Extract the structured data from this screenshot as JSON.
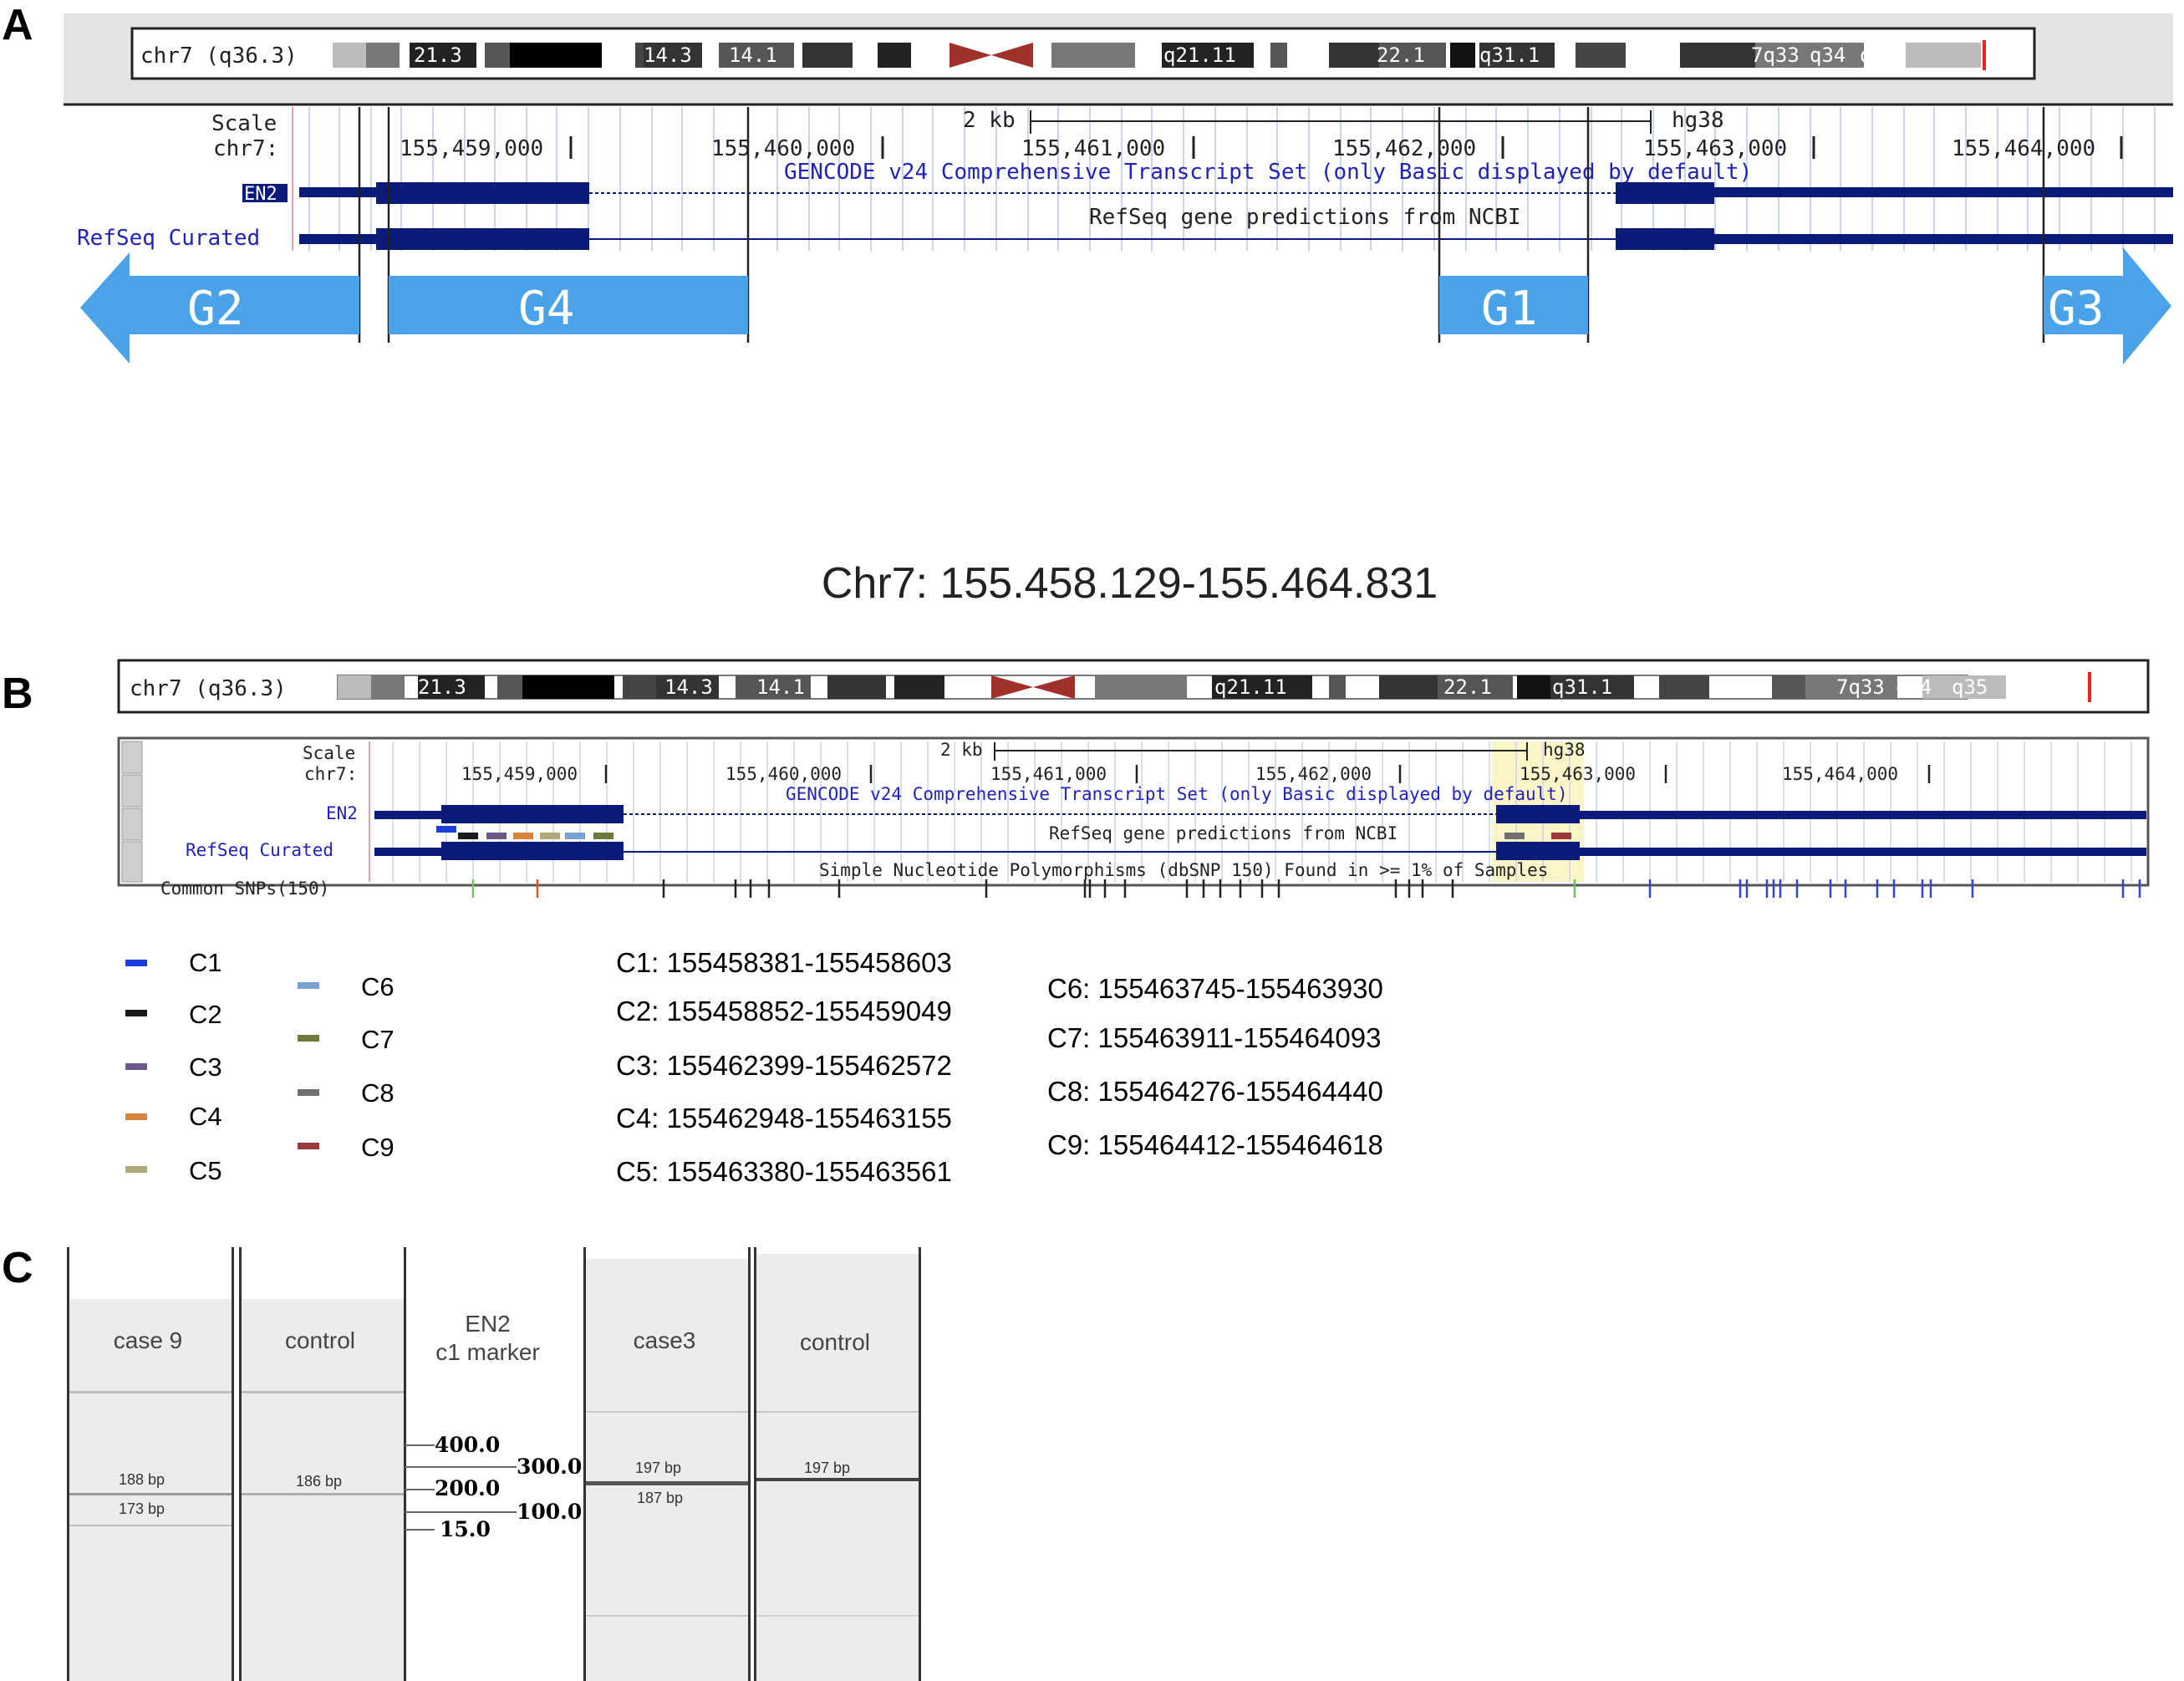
{
  "panels": {
    "a": {
      "letter": "A"
    },
    "b": {
      "letter": "B"
    },
    "c": {
      "letter": "C"
    }
  },
  "ideogram": {
    "chrom_label": "chr7 (q36.3)",
    "bands": [
      "21.3",
      "14.3",
      "14.1",
      "q21.11",
      "22.1",
      "q31.1",
      "7q33",
      "q34",
      "q35"
    ]
  },
  "panel_a": {
    "scale_label": "Scale",
    "chr_label": "chr7:",
    "scale_value": "2 kb",
    "assembly": "hg38",
    "positions": [
      "155,459,000",
      "155,460,000",
      "155,461,000",
      "155,462,000",
      "155,463,000",
      "155,464,000"
    ],
    "gencode_text": "GENCODE v24 Comprehensive Transcript Set (only Basic displayed by default)",
    "track_en2": "EN2",
    "refseq_label": "RefSeq Curated",
    "refseq_text": "RefSeq gene predictions from NCBI",
    "guides": [
      "G2",
      "G4",
      "G1",
      "G3"
    ],
    "colors": {
      "arrow": "#4aa3e8",
      "gene": "#0c1a7a",
      "label_blue": "#2222bb"
    }
  },
  "region_title": "Chr7: 155.458.129-155.464.831",
  "panel_b": {
    "scale_label": "Scale",
    "chr_label": "chr7:",
    "scale_value": "2 kb",
    "assembly": "hg38",
    "positions": [
      "155,459,000",
      "155,460,000",
      "155,461,000",
      "155,462,000",
      "155,463,000",
      "155,464,000"
    ],
    "gencode_text": "GENCODE v24 Comprehensive Transcript Set (only Basic displayed by default)",
    "track_en2": "EN2",
    "refseq_label": "RefSeq Curated",
    "refseq_text": "RefSeq gene predictions from NCBI",
    "snp_label": "Common SNPs(150)",
    "snp_text": "Simple Nucleotide Polymorphisms (dbSNP 150) Found in >= 1% of Samples"
  },
  "legend": {
    "items": [
      {
        "name": "C1",
        "color": "#1f3fdc"
      },
      {
        "name": "C2",
        "color": "#1a1a1a"
      },
      {
        "name": "C3",
        "color": "#6a5a8c"
      },
      {
        "name": "C4",
        "color": "#d9823a"
      },
      {
        "name": "C5",
        "color": "#b0a878"
      },
      {
        "name": "C6",
        "color": "#7ba0d2"
      },
      {
        "name": "C7",
        "color": "#6a7a3a"
      },
      {
        "name": "C8",
        "color": "#707070"
      },
      {
        "name": "C9",
        "color": "#9a3a3a"
      }
    ],
    "coords_left": [
      "C1: 155458381-155458603",
      "C2: 155458852-155459049",
      "C3: 155462399-155462572",
      "C4: 155462948-155463155",
      "C5: 155463380-155463561"
    ],
    "coords_right": [
      "C6: 155463745-155463930",
      "C7: 155463911-155464093",
      "C8: 155464276-155464440",
      "C9: 155464412-155464618"
    ]
  },
  "panel_c": {
    "lanes": [
      {
        "label": "case 9",
        "bands": [
          "188 bp",
          "173 bp"
        ]
      },
      {
        "label": "control",
        "bands": [
          "186 bp"
        ]
      },
      {
        "label": "case3",
        "bands": [
          "197 bp",
          "187 bp"
        ]
      },
      {
        "label": "control",
        "bands": [
          "197 bp"
        ]
      }
    ],
    "marker_title_1": "EN2",
    "marker_title_2": "c1 marker",
    "marker_left": [
      "400.0",
      "200.0",
      "15.0"
    ],
    "marker_right": [
      "300.0",
      "100.0"
    ]
  }
}
